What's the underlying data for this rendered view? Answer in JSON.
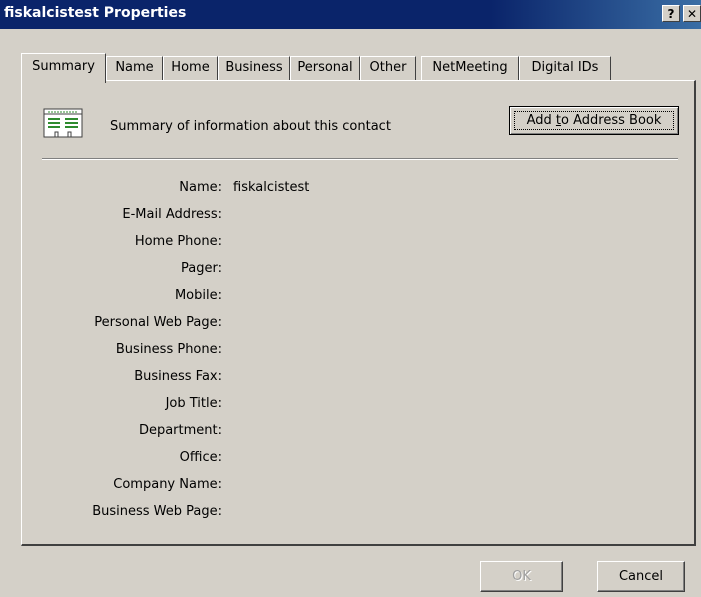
{
  "window": {
    "title": "fiskalcistest Properties",
    "help_label": "?",
    "close_label": "✕"
  },
  "tabs": [
    {
      "label": "Summary",
      "active": true
    },
    {
      "label": "Name"
    },
    {
      "label": "Home"
    },
    {
      "label": "Business"
    },
    {
      "label": "Personal"
    },
    {
      "label": "Other"
    },
    {
      "label": "NetMeeting"
    },
    {
      "label": "Digital IDs"
    }
  ],
  "summary": {
    "icon": "contact-card-icon",
    "description": "Summary of information about this contact",
    "add_button_label": "Add to Address Book",
    "add_button_access_key": "t"
  },
  "fields": [
    {
      "label": "Name:",
      "value": "fiskalcistest"
    },
    {
      "label": "E-Mail Address:",
      "value": ""
    },
    {
      "label": "Home Phone:",
      "value": ""
    },
    {
      "label": "Pager:",
      "value": ""
    },
    {
      "label": "Mobile:",
      "value": ""
    },
    {
      "label": "Personal Web Page:",
      "value": ""
    },
    {
      "label": "Business Phone:",
      "value": ""
    },
    {
      "label": "Business Fax:",
      "value": ""
    },
    {
      "label": "Job Title:",
      "value": ""
    },
    {
      "label": "Department:",
      "value": ""
    },
    {
      "label": "Office:",
      "value": ""
    },
    {
      "label": "Company Name:",
      "value": ""
    },
    {
      "label": "Business Web Page:",
      "value": ""
    }
  ],
  "buttons": {
    "ok_label": "OK",
    "ok_enabled": false,
    "cancel_label": "Cancel"
  },
  "colors": {
    "titlebar": "#0a246a",
    "dialog_face": "#d4d0c8",
    "icon_green": "#2e8b2e"
  }
}
